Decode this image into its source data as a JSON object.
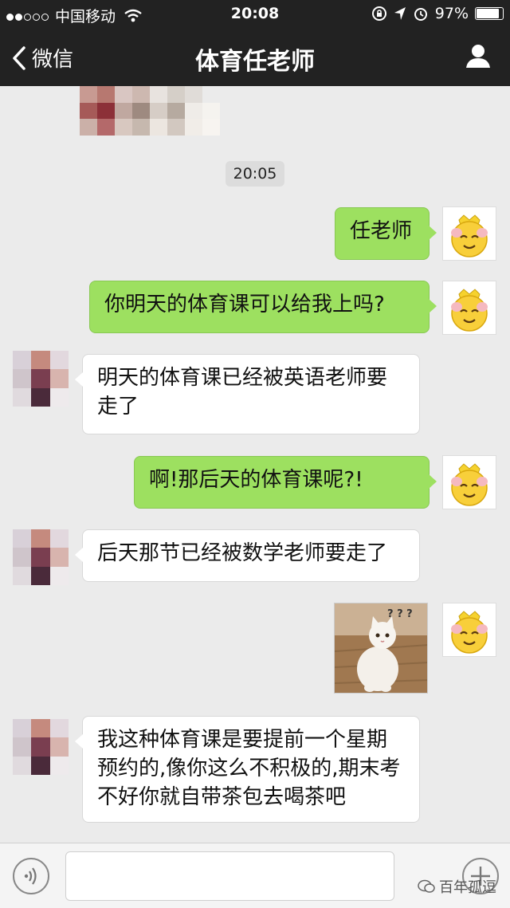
{
  "status_bar": {
    "carrier": "中国移动",
    "time": "20:08",
    "battery": "97%"
  },
  "nav": {
    "back_label": "微信",
    "title": "体育任老师"
  },
  "timestamp": "20:05",
  "messages": [
    {
      "side": "out",
      "text": "任老师"
    },
    {
      "side": "out",
      "text": "你明天的体育课可以给我上吗?"
    },
    {
      "side": "in",
      "text": "明天的体育课已经被英语老师要走了"
    },
    {
      "side": "out",
      "text": "啊!那后天的体育课呢?!"
    },
    {
      "side": "in",
      "text": "后天那节已经被数学老师要走了"
    },
    {
      "side": "out",
      "type": "image",
      "caption": "? ? ?"
    },
    {
      "side": "in",
      "text": "我这种体育课是要提前一个星期预约的,像你这么不积极的,期末考不好你就自带茶包去喝茶吧"
    }
  ],
  "watermark": "百年孤逗",
  "colors": {
    "out_bubble": "#9de060",
    "in_bubble": "#ffffff",
    "nav_background": "#222222",
    "chat_background": "#ebebeb"
  },
  "icons": [
    "signal-dots-icon",
    "wifi-icon",
    "lock-rotation-icon",
    "location-icon",
    "alarm-icon",
    "battery-icon",
    "back-chevron-icon",
    "user-profile-icon",
    "voice-icon",
    "plus-icon",
    "emoji-avatar-icon"
  ]
}
